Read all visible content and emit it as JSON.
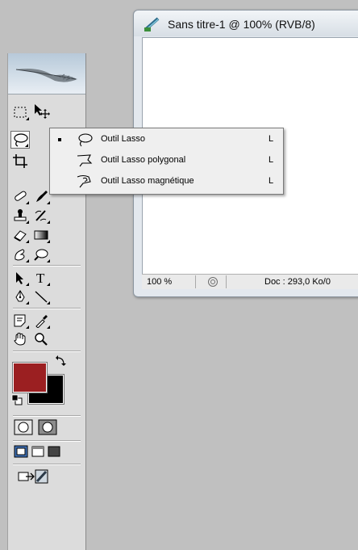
{
  "document": {
    "title": "Sans titre-1 @ 100% (RVB/8)",
    "zoom": "100 %",
    "doc_size": "Doc : 293,0 Ko/0"
  },
  "flyout": {
    "items": [
      {
        "label": "Outil Lasso",
        "shortcut": "L",
        "icon": "lasso-icon",
        "selected": true
      },
      {
        "label": "Outil Lasso polygonal",
        "shortcut": "L",
        "icon": "polygonal-lasso-icon",
        "selected": false
      },
      {
        "label": "Outil Lasso magnétique",
        "shortcut": "L",
        "icon": "magnetic-lasso-icon",
        "selected": false
      }
    ]
  },
  "colors": {
    "foreground": "#9b1f21",
    "background": "#000000"
  }
}
